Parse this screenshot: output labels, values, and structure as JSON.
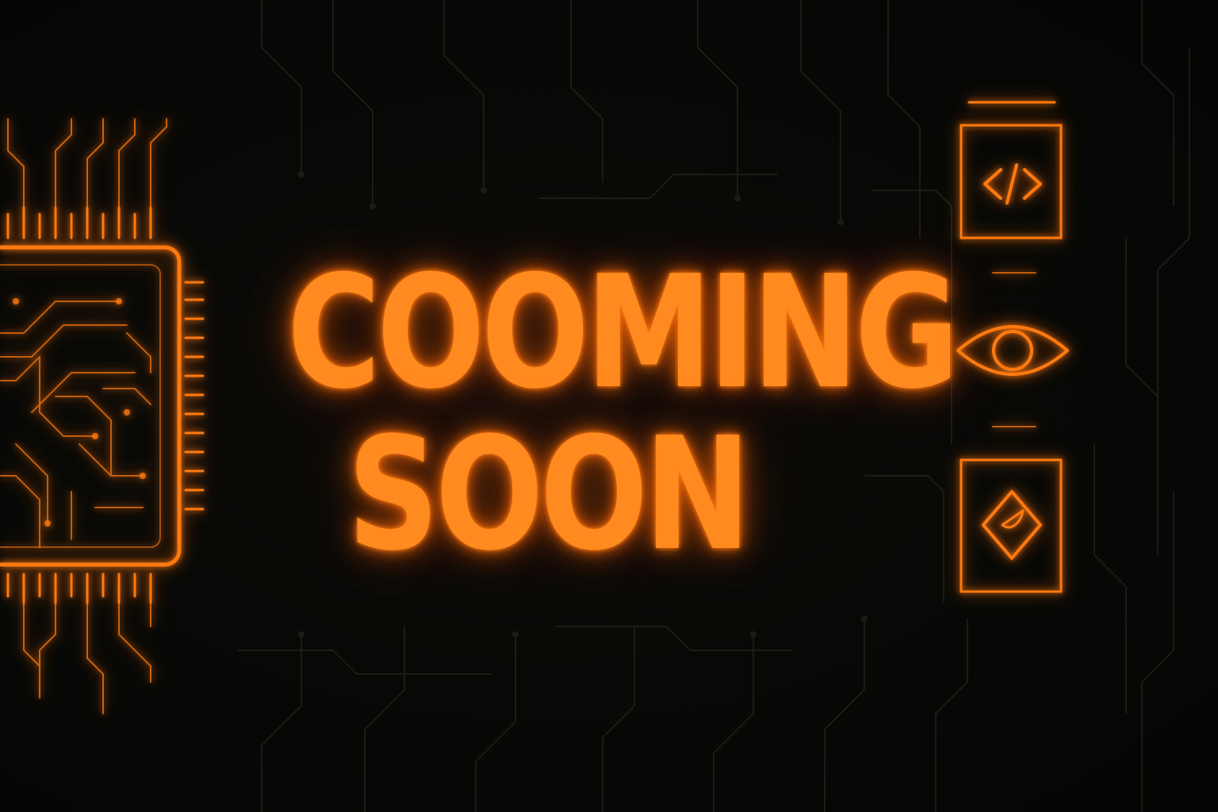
{
  "headline": {
    "line1": "COOMING",
    "line2": "SOON"
  },
  "icons": [
    {
      "name": "code-file-icon"
    },
    {
      "name": "eye-icon"
    },
    {
      "name": "design-diamond-icon"
    }
  ],
  "colors": {
    "background": "#070806",
    "accent": "#ff8a1f",
    "glow": "#ff7a10",
    "circuit_dim": "#1a1a12"
  }
}
